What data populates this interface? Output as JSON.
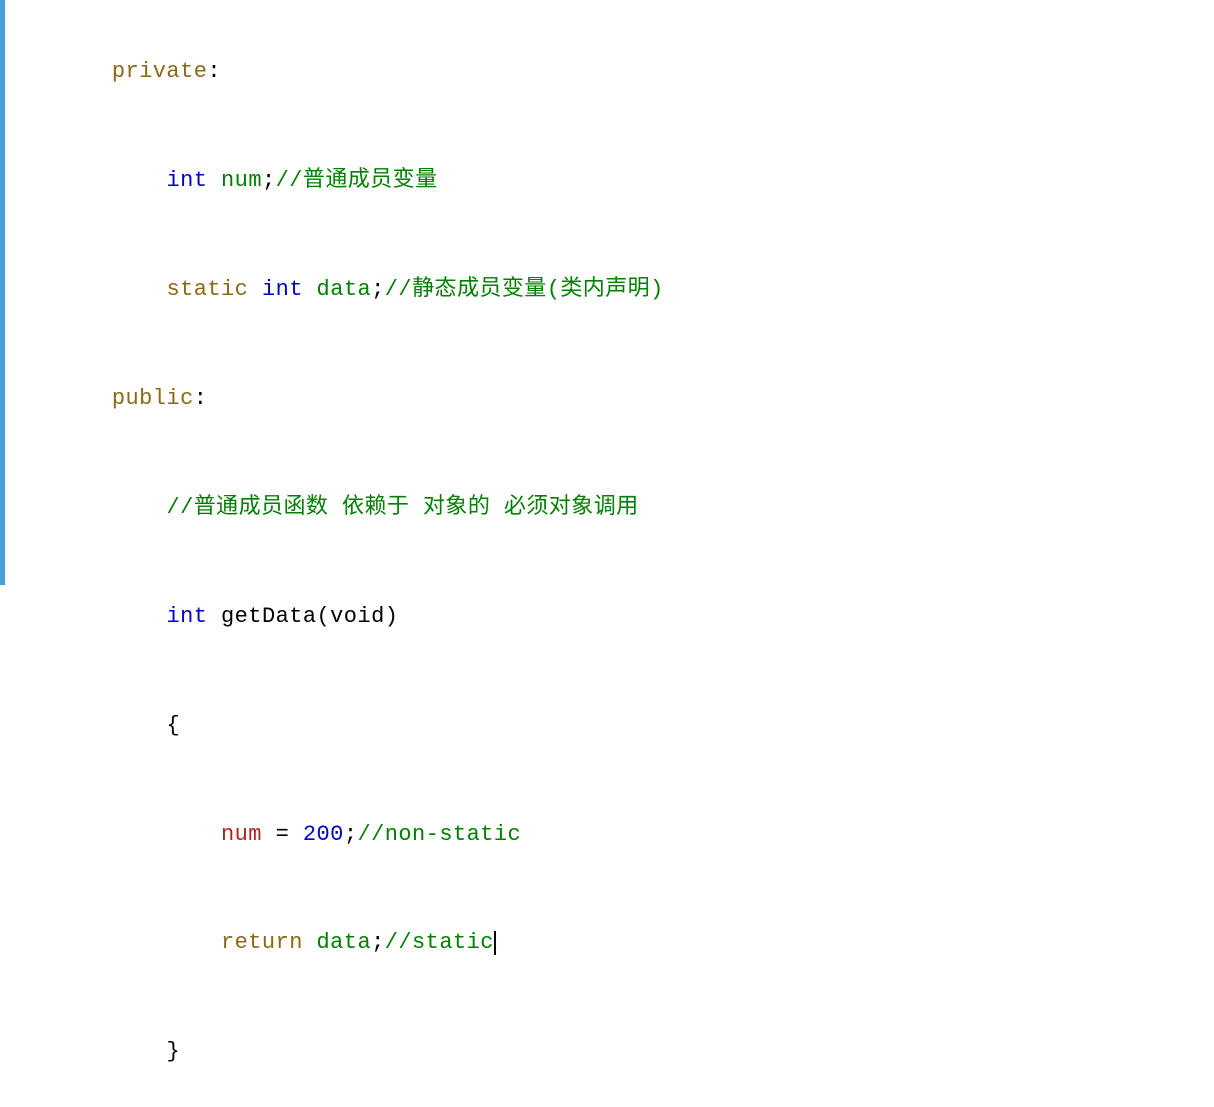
{
  "code": {
    "lines": [
      {
        "id": "line1",
        "parts": [
          {
            "text": "private",
            "class": "keyword"
          },
          {
            "text": ":",
            "class": "normal"
          }
        ]
      },
      {
        "id": "line2",
        "parts": [
          {
            "text": "    ",
            "class": "normal"
          },
          {
            "text": "int",
            "class": "type"
          },
          {
            "text": " ",
            "class": "normal"
          },
          {
            "text": "num",
            "class": "identifier"
          },
          {
            "text": ";",
            "class": "normal"
          },
          {
            "text": "//普通成员变量",
            "class": "comment"
          }
        ]
      },
      {
        "id": "line3",
        "parts": [
          {
            "text": "    ",
            "class": "normal"
          },
          {
            "text": "static",
            "class": "keyword"
          },
          {
            "text": " ",
            "class": "normal"
          },
          {
            "text": "int",
            "class": "type"
          },
          {
            "text": " ",
            "class": "normal"
          },
          {
            "text": "data",
            "class": "identifier"
          },
          {
            "text": ";",
            "class": "normal"
          },
          {
            "text": "//静态成员变量(类内声明)",
            "class": "comment"
          }
        ]
      },
      {
        "id": "line4",
        "parts": [
          {
            "text": "public",
            "class": "keyword"
          },
          {
            "text": ":",
            "class": "normal"
          }
        ]
      },
      {
        "id": "line5",
        "parts": [
          {
            "text": "    ",
            "class": "normal"
          },
          {
            "text": "//普通成员函数 依赖于 对象的 必须对象调用",
            "class": "comment"
          }
        ]
      },
      {
        "id": "line6",
        "parts": [
          {
            "text": "    ",
            "class": "normal"
          },
          {
            "text": "int",
            "class": "type"
          },
          {
            "text": " ",
            "class": "normal"
          },
          {
            "text": "getData",
            "class": "normal"
          },
          {
            "text": "(void)",
            "class": "normal"
          }
        ]
      },
      {
        "id": "line7",
        "parts": [
          {
            "text": "    ",
            "class": "normal"
          },
          {
            "text": "{",
            "class": "brace"
          }
        ]
      },
      {
        "id": "line8",
        "parts": [
          {
            "text": "        ",
            "class": "normal"
          },
          {
            "text": "num",
            "class": "number"
          },
          {
            "text": " = ",
            "class": "normal"
          },
          {
            "text": "200",
            "class": "type"
          },
          {
            "text": ";",
            "class": "normal"
          },
          {
            "text": "//non-static",
            "class": "comment"
          }
        ]
      },
      {
        "id": "line9",
        "parts": [
          {
            "text": "        ",
            "class": "normal"
          },
          {
            "text": "return",
            "class": "keyword"
          },
          {
            "text": " ",
            "class": "normal"
          },
          {
            "text": "data",
            "class": "identifier"
          },
          {
            "text": ";",
            "class": "normal"
          },
          {
            "text": "//static",
            "class": "comment"
          },
          {
            "text": "CURSOR",
            "class": "cursor"
          }
        ]
      },
      {
        "id": "line10",
        "parts": [
          {
            "text": "    ",
            "class": "normal"
          },
          {
            "text": "}",
            "class": "brace"
          }
        ]
      }
    ]
  }
}
